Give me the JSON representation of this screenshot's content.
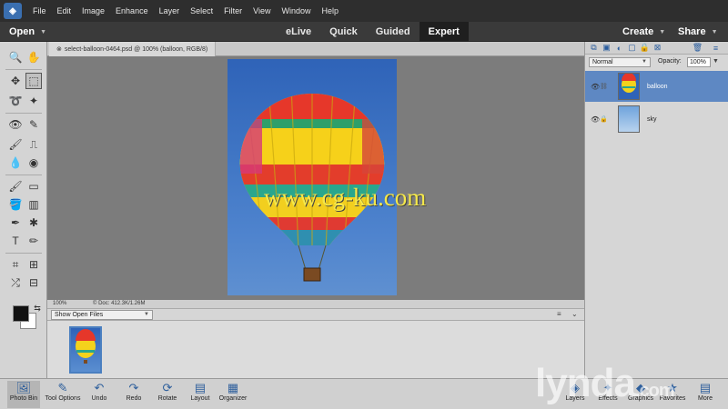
{
  "menubar": {
    "items": [
      "File",
      "Edit",
      "Image",
      "Enhance",
      "Layer",
      "Select",
      "Filter",
      "View",
      "Window",
      "Help"
    ]
  },
  "modebar": {
    "open_label": "Open",
    "tabs": [
      {
        "label": "eLive"
      },
      {
        "label": "Quick"
      },
      {
        "label": "Guided"
      },
      {
        "label": "Expert"
      }
    ],
    "active_tab": "Expert",
    "create_label": "Create",
    "share_label": "Share"
  },
  "document": {
    "tab_title": "select-balloon-0464.psd @ 100% (balloon, RGB/8)",
    "zoom": "100%",
    "doc_info": "Doc: 412.3K/1.26M"
  },
  "photo_bin": {
    "show_files": "Show Open Files"
  },
  "layers": {
    "blend_mode": "Normal",
    "opacity_label": "Opacity:",
    "opacity": "100%",
    "items": [
      {
        "name": "balloon",
        "selected": true
      },
      {
        "name": "sky",
        "selected": false
      }
    ]
  },
  "taskbar": {
    "left": [
      {
        "label": "Photo Bin",
        "icon": "photo-bin-icon"
      },
      {
        "label": "Tool Options",
        "icon": "tool-options-icon"
      },
      {
        "label": "Undo",
        "icon": "undo-icon"
      },
      {
        "label": "Redo",
        "icon": "redo-icon"
      },
      {
        "label": "Rotate",
        "icon": "rotate-icon"
      },
      {
        "label": "Layout",
        "icon": "layout-icon"
      },
      {
        "label": "Organizer",
        "icon": "organizer-icon"
      }
    ],
    "right": [
      {
        "label": "Layers",
        "icon": "layers-icon"
      },
      {
        "label": "Effects",
        "icon": "effects-icon"
      },
      {
        "label": "Graphics",
        "icon": "graphics-icon"
      },
      {
        "label": "Favorites",
        "icon": "favorites-icon"
      },
      {
        "label": "More",
        "icon": "more-icon"
      }
    ]
  },
  "overlay": {
    "watermark_text": "www.cg-ku.com",
    "brand_text": "lynda",
    "brand_suffix": ".com"
  },
  "colors": {
    "accent_blue": "#5e88c3",
    "active_tab_bg": "#1f1f1f"
  }
}
